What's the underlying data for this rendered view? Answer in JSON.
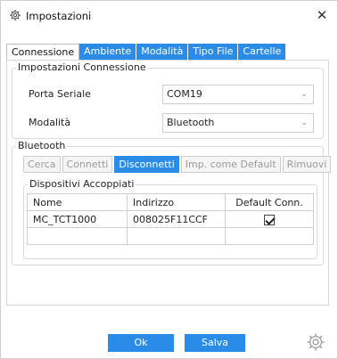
{
  "window": {
    "title": "Impostazioni",
    "title_icon": "gear-icon",
    "close_glyph": "✕"
  },
  "tabs": [
    {
      "label": "Connessione",
      "active": true
    },
    {
      "label": "Ambiente",
      "active": false
    },
    {
      "label": "Modalità",
      "active": false
    },
    {
      "label": "Tipo File",
      "active": false
    },
    {
      "label": "Cartelle",
      "active": false
    }
  ],
  "connection": {
    "group_title": "Impostazioni Connessione",
    "serial_port_label": "Porta Seriale",
    "serial_port_value": "COM19",
    "mode_label": "Modalità",
    "mode_value": "Bluetooth"
  },
  "bluetooth": {
    "group_title": "Bluetooth",
    "buttons": {
      "search": "Cerca",
      "connect": "Connetti",
      "disconnect": "Disconnetti",
      "set_default": "Imp. come Default",
      "remove": "Rimuovi"
    },
    "paired_title": "Dispositivi Accoppiati",
    "columns": [
      "Nome",
      "Indirizzo",
      "Default Conn."
    ],
    "rows": [
      {
        "name": "MC_TCT1000",
        "address": "008025F11CCF",
        "default": true
      }
    ]
  },
  "footer": {
    "ok": "Ok",
    "save": "Salva",
    "settings_icon": "gear-icon"
  },
  "colors": {
    "accent": "#2b8ce8",
    "border": "#cfcfcf"
  }
}
